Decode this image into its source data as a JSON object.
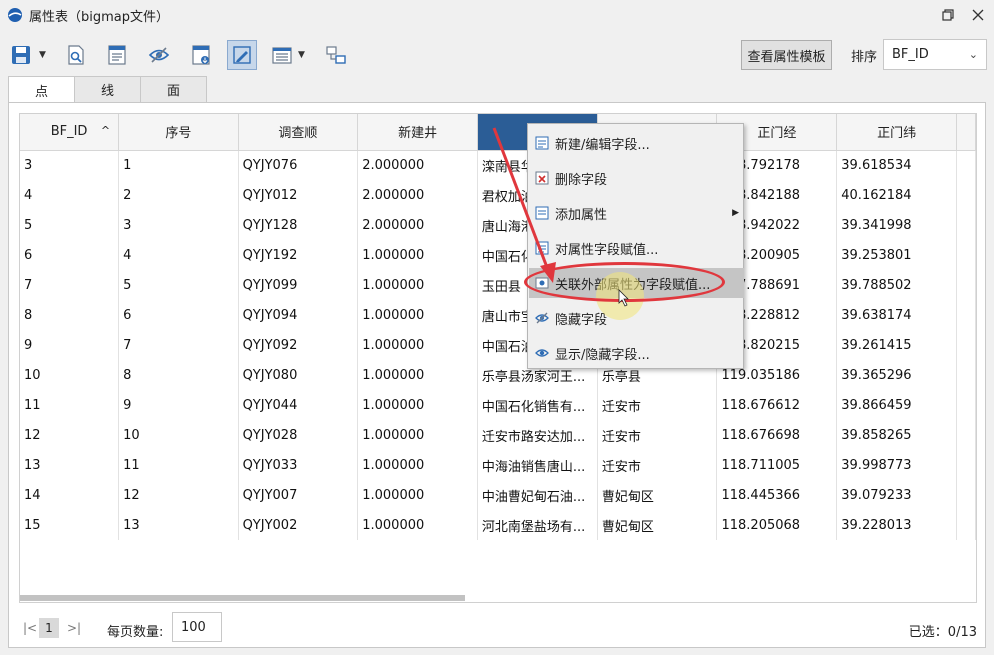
{
  "window": {
    "title": "属性表（bigmap文件）"
  },
  "toolbar": {
    "template_button": "查看属性模板",
    "sort_label": "排序",
    "sort_value": "BF_ID"
  },
  "tabs": [
    {
      "label": "点",
      "selected": true
    },
    {
      "label": "线",
      "selected": false
    },
    {
      "label": "面",
      "selected": false
    }
  ],
  "table": {
    "columns": [
      "BF_ID",
      "序号",
      "调查顺",
      "新建井",
      "",
      "",
      "正门经",
      "正门纬"
    ],
    "rows": [
      [
        "3",
        "1",
        "QYJY076",
        "2.000000",
        "滦南县华",
        "",
        "118.792178",
        "39.618534"
      ],
      [
        "4",
        "2",
        "QYJY012",
        "2.000000",
        "君权加油",
        "",
        "118.842188",
        "40.162184"
      ],
      [
        "5",
        "3",
        "QYJY128",
        "2.000000",
        "唐山海港",
        "",
        "118.942022",
        "39.341998"
      ],
      [
        "6",
        "4",
        "QYJY192",
        "1.000000",
        "中国石化",
        "",
        "118.200905",
        "39.253801"
      ],
      [
        "7",
        "5",
        "QYJY099",
        "1.000000",
        "玉田县",
        "",
        "117.788691",
        "39.788502"
      ],
      [
        "8",
        "6",
        "QYJY094",
        "1.000000",
        "唐山市宝",
        "",
        "118.228812",
        "39.638174"
      ],
      [
        "9",
        "7",
        "QYJY092",
        "1.000000",
        "中国石油",
        "",
        "118.820215",
        "39.261415"
      ],
      [
        "10",
        "8",
        "QYJY080",
        "1.000000",
        "乐亭县汤家河王...",
        "乐亭县",
        "119.035186",
        "39.365296"
      ],
      [
        "11",
        "9",
        "QYJY044",
        "1.000000",
        "中国石化销售有...",
        "迁安市",
        "118.676612",
        "39.866459"
      ],
      [
        "12",
        "10",
        "QYJY028",
        "1.000000",
        "迁安市路安达加...",
        "迁安市",
        "118.676698",
        "39.858265"
      ],
      [
        "13",
        "11",
        "QYJY033",
        "1.000000",
        "中海油销售唐山...",
        "迁安市",
        "118.711005",
        "39.998773"
      ],
      [
        "14",
        "12",
        "QYJY007",
        "1.000000",
        "中油曹妃甸石油...",
        "曹妃甸区",
        "118.445366",
        "39.079233"
      ],
      [
        "15",
        "13",
        "QYJY002",
        "1.000000",
        "河北南堡盐场有...",
        "曹妃甸区",
        "118.205068",
        "39.228013"
      ]
    ]
  },
  "context_menu": {
    "items": [
      {
        "label": "新建/编辑字段...",
        "icon": "edit-field-icon",
        "submenu": false,
        "hover": false
      },
      {
        "label": "删除字段",
        "icon": "delete-field-icon",
        "submenu": false,
        "hover": false
      },
      {
        "label": "添加属性",
        "icon": "add-attribute-icon",
        "submenu": true,
        "hover": false
      },
      {
        "label": "对属性字段赋值...",
        "icon": "assign-field-icon",
        "submenu": false,
        "hover": false
      },
      {
        "label": "关联外部属性为字段赋值...",
        "icon": "link-external-icon",
        "submenu": false,
        "hover": true
      },
      {
        "label": "隐藏字段",
        "icon": "hide-field-icon",
        "submenu": false,
        "hover": false
      },
      {
        "label": "显示/隐藏字段...",
        "icon": "show-hide-field-icon",
        "submenu": false,
        "hover": false
      }
    ]
  },
  "pager": {
    "current_page": "1",
    "per_page_label": "每页数量:",
    "per_page_value": "100",
    "selected_count": "已选：0/13"
  },
  "colors": {
    "header_highlight": "#2b5d96",
    "annotation_red": "#e0373d",
    "menu_hover": "#c5c5c5"
  }
}
